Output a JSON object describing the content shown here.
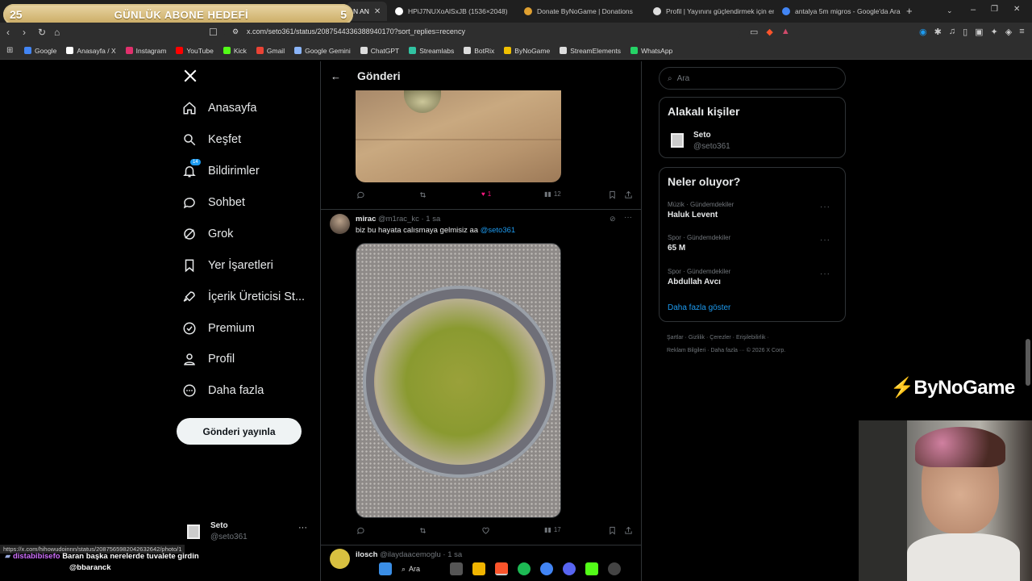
{
  "overlay": {
    "goal_left": "25",
    "goal_title": "GÜNLÜK ABONE HEDEFİ",
    "goal_right": "5",
    "brand": "ByNoGame",
    "chat_user": "distabibisefo",
    "chat_message": "Baran başka nerelerde tuvalete girdin",
    "chat_mention": "@bbaranck",
    "status_url": "https://x.com/hihowudoinnn/status/2087565982042632642/photo/1"
  },
  "browser": {
    "tabs": [
      {
        "title": "N AN"
      },
      {
        "title": "HPiJ7NUXoAlSxJB (1536×2048)"
      },
      {
        "title": "Donate ByNoGame | Donations"
      },
      {
        "title": "Profil | Yayınını güçlendirmek için en"
      },
      {
        "title": "antalya 5m migros - Google'da Ara"
      }
    ],
    "url": "x.com/seto361/status/2087544336388940170?sort_replies=recency",
    "bookmarks": [
      {
        "label": "Google",
        "color": "#4285f4"
      },
      {
        "label": "Anasayfa / X",
        "color": "#ffffff"
      },
      {
        "label": "Instagram",
        "color": "#e1306c"
      },
      {
        "label": "YouTube",
        "color": "#ff0000"
      },
      {
        "label": "Kick",
        "color": "#53fc18"
      },
      {
        "label": "Gmail",
        "color": "#ea4335"
      },
      {
        "label": "Google Gemini",
        "color": "#8ab4f8"
      },
      {
        "label": "ChatGPT",
        "color": "#dddddd"
      },
      {
        "label": "Streamlabs",
        "color": "#31c3a2"
      },
      {
        "label": "BotRix",
        "color": "#dddddd"
      },
      {
        "label": "ByNoGame",
        "color": "#f0c000"
      },
      {
        "label": "StreamElements",
        "color": "#dddddd"
      },
      {
        "label": "WhatsApp",
        "color": "#25d366"
      }
    ]
  },
  "sidebar": {
    "items": [
      {
        "label": "Anasayfa",
        "icon": "home-icon"
      },
      {
        "label": "Keşfet",
        "icon": "search-icon"
      },
      {
        "label": "Bildirimler",
        "icon": "bell-icon",
        "badge": "14"
      },
      {
        "label": "Sohbet",
        "icon": "chat-icon"
      },
      {
        "label": "Grok",
        "icon": "grok-icon"
      },
      {
        "label": "Yer İşaretleri",
        "icon": "bookmark-icon"
      },
      {
        "label": "İçerik Üreticisi St...",
        "icon": "rocket-icon"
      },
      {
        "label": "Premium",
        "icon": "verified-icon"
      },
      {
        "label": "Profil",
        "icon": "person-icon"
      },
      {
        "label": "Daha fazla",
        "icon": "more-circle-icon"
      }
    ],
    "post_button": "Gönderi yayınla",
    "profile_name": "Seto",
    "profile_handle": "@seto361"
  },
  "main": {
    "header_title": "Gönderi",
    "tweet1": {
      "likes": "1",
      "views": "12"
    },
    "tweet2": {
      "name": "mirac",
      "handle": "@m1rac_kc",
      "time": "· 1 sa",
      "text": "biz bu hayata calısmaya gelmisiz aa",
      "mention": "@seto361",
      "views": "17"
    },
    "tweet3": {
      "name": "ilosch",
      "handle": "@ilaydaacemoglu",
      "time": "· 1 sa"
    }
  },
  "right": {
    "search_placeholder": "Ara",
    "people_title": "Alakalı kişiler",
    "person_name": "Seto",
    "person_handle": "@seto361",
    "trends_title": "Neler oluyor?",
    "trends": [
      {
        "meta": "Müzik · Gündemdekiler",
        "name": "Haluk Levent"
      },
      {
        "meta": "Spor · Gündemdekiler",
        "name": "65 M"
      },
      {
        "meta": "Spor · Gündemdekiler",
        "name": "Abdullah Avcı"
      }
    ],
    "show_more": "Daha fazla göster",
    "footer_line1": "Şartlar  ·  Gizlilik  ·  Çerezler  ·  Erişilebilirlik  ·",
    "footer_line2": "Reklam Bilgileri  ·  Daha fazla ···  © 2026 X Corp."
  },
  "taskbar": {
    "search_label": "Ara"
  },
  "colors": {
    "accent": "#1d9bf0",
    "like": "#f91880",
    "bg": "#000000",
    "border": "#2f3336"
  }
}
